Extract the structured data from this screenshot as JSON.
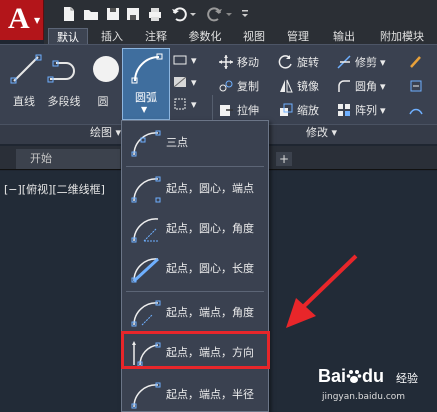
{
  "app": {
    "logo_letter": "A"
  },
  "ribbon": {
    "tabs": [
      {
        "label": "默认",
        "active": true
      },
      {
        "label": "插入",
        "active": false
      },
      {
        "label": "注释",
        "active": false
      },
      {
        "label": "参数化",
        "active": false
      },
      {
        "label": "视图",
        "active": false
      },
      {
        "label": "管理",
        "active": false
      },
      {
        "label": "输出",
        "active": false
      },
      {
        "label": "附加模块",
        "active": false
      }
    ],
    "draw": {
      "line": "直线",
      "polyline": "多段线",
      "circle": "圆",
      "arc": "圆弧",
      "panel_title": "绘图 ▾"
    },
    "modify": {
      "move": "移动",
      "rotate": "旋转",
      "trim": "修剪",
      "copy": "复制",
      "mirror": "镜像",
      "fillet": "圆角",
      "stretch": "拉伸",
      "scale": "缩放",
      "array": "阵列",
      "panel_title": "修改 ▾"
    }
  },
  "file_tab": {
    "label": "开始"
  },
  "viewport": {
    "label": "[−][俯视][二维线框]"
  },
  "arc_menu": {
    "items": [
      {
        "label": "三点"
      },
      {
        "label": "起点，圆心，端点"
      },
      {
        "label": "起点，圆心，角度"
      },
      {
        "label": "起点，圆心，长度"
      },
      {
        "label": "起点，端点，角度"
      },
      {
        "label": "起点，端点，方向",
        "highlighted": true
      },
      {
        "label": "起点，端点，半径"
      }
    ]
  },
  "watermark": {
    "brand": "Bai",
    "brand2": "du",
    "suffix": "经验",
    "url": "jingyan.baidu.com"
  },
  "colors": {
    "highlight": "#e8262a",
    "app_red": "#b3151a",
    "ribbon": "#3a4150"
  }
}
